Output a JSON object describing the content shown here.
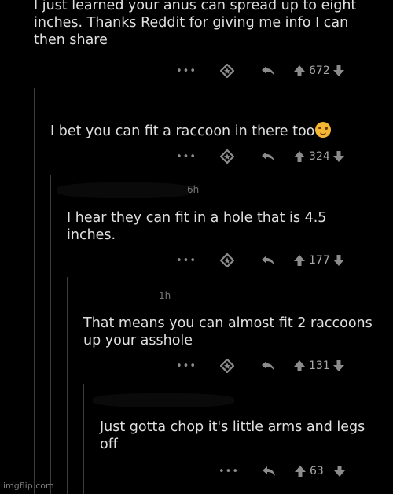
{
  "comments": [
    {
      "body": "I just learned your anus can spread up to eight inches. Thanks Reddit for giving me info I can then share",
      "more": "•••",
      "score": "672"
    },
    {
      "body": "I bet you can fit a raccoon in there too",
      "emoji": "winking-face",
      "more": "•••",
      "score": "324",
      "meta_tail": ""
    },
    {
      "body": "I hear they can fit in a hole that is 4.5 inches.",
      "more": "•••",
      "score": "177",
      "meta_tail": "6h"
    },
    {
      "body": "That means you can almost fit 2 raccoons up your asshole",
      "more": "•••",
      "score": "131",
      "meta_tail": "1h"
    },
    {
      "body": "Just gotta chop it's little arms and legs off",
      "more": "•••",
      "score": "63",
      "meta_tail": ""
    }
  ],
  "watermark": "imgflip.com",
  "icons": {
    "award": "award-icon",
    "reply": "reply-icon",
    "upvote": "upvote-arrow-icon",
    "downvote": "downvote-arrow-icon",
    "more": "more-options-icon"
  },
  "colors": {
    "background": "#000000",
    "text": "#e0e0e0",
    "icon": "#8c8c8c",
    "rail": "#3c3c3c"
  }
}
